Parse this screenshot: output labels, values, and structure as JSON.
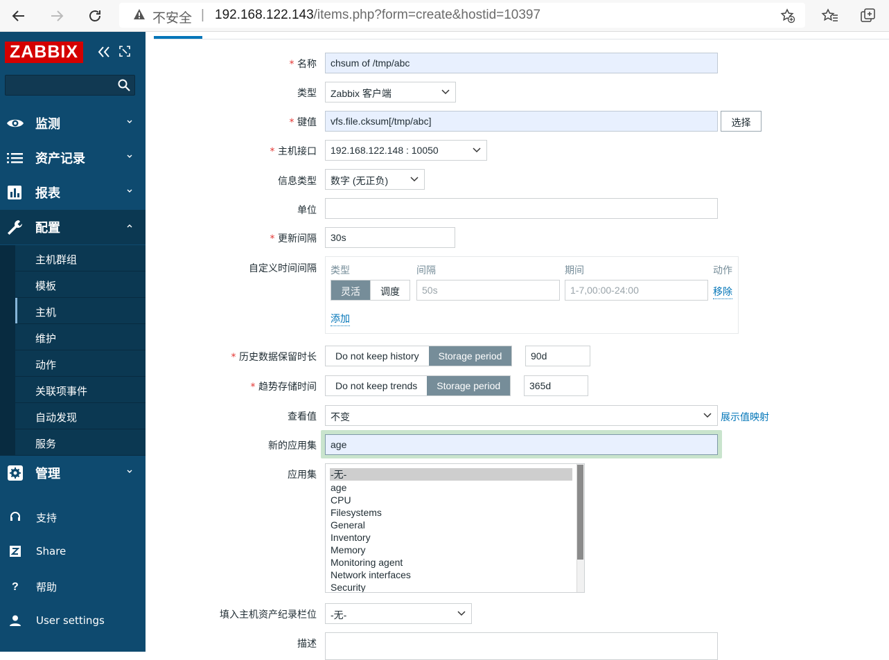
{
  "browser": {
    "insecure_label": "不安全",
    "separator": "|",
    "url_host": "192.168.122.143",
    "url_path": "/items.php?form=create&hostid=10397"
  },
  "sidebar": {
    "logo": "ZABBIX",
    "menu": [
      {
        "label": "监测",
        "icon": "eye-icon"
      },
      {
        "label": "资产记录",
        "icon": "list-icon"
      },
      {
        "label": "报表",
        "icon": "bar-chart-icon"
      },
      {
        "label": "配置",
        "icon": "wrench-icon"
      },
      {
        "label": "管理",
        "icon": "gear-icon"
      }
    ],
    "config_sub": [
      "主机群组",
      "模板",
      "主机",
      "维护",
      "动作",
      "关联项事件",
      "自动发现",
      "服务"
    ],
    "bottom": [
      {
        "label": "支持",
        "icon": "headset-icon"
      },
      {
        "label": "Share",
        "icon": "share-z-icon"
      },
      {
        "label": "帮助",
        "icon": "question-icon"
      },
      {
        "label": "User settings",
        "icon": "user-icon"
      }
    ]
  },
  "form": {
    "name_label": "名称",
    "name_value": "chsum of /tmp/abc",
    "type_label": "类型",
    "type_value": "Zabbix 客户端",
    "key_label": "键值",
    "key_value": "vfs.file.cksum[/tmp/abc]",
    "key_select_btn": "选择",
    "iface_label": "主机接口",
    "iface_value": "192.168.122.148 : 10050",
    "info_type_label": "信息类型",
    "info_type_value": "数字 (无正负)",
    "units_label": "单位",
    "units_value": "",
    "interval_label": "更新间隔",
    "interval_value": "30s",
    "custom_label": "自定义时间间隔",
    "custom": {
      "col_type": "类型",
      "col_interval": "间隔",
      "col_period": "期间",
      "col_action": "动作",
      "seg_flexible": "灵活",
      "seg_scheduling": "调度",
      "interval_placeholder": "50s",
      "period_placeholder": "1-7,00:00-24:00",
      "remove_link": "移除",
      "add_link": "添加"
    },
    "history_label": "历史数据保留时长",
    "history_opt_no": "Do not keep history",
    "history_opt_period": "Storage period",
    "history_value": "90d",
    "trends_label": "趋势存储时间",
    "trends_opt_no": "Do not keep trends",
    "trends_opt_period": "Storage period",
    "trends_value": "365d",
    "valuemap_label": "查看值",
    "valuemap_value": "不变",
    "valuemap_link": "展示值映射",
    "newapp_label": "新的应用集",
    "newapp_value": "age",
    "apps_label": "应用集",
    "apps_options": [
      "-无-",
      "age",
      "CPU",
      "Filesystems",
      "General",
      "Inventory",
      "Memory",
      "Monitoring agent",
      "Network interfaces",
      "Security"
    ],
    "inventory_label": "填入主机资产纪录栏位",
    "inventory_value": "-无-",
    "desc_label": "描述"
  },
  "colors": {
    "sidebar_bg": "#0e4a6f",
    "logo_red": "#d40000",
    "accent_blue": "#0275b8",
    "segment_on": "#768d99",
    "required_red": "#e33734"
  }
}
